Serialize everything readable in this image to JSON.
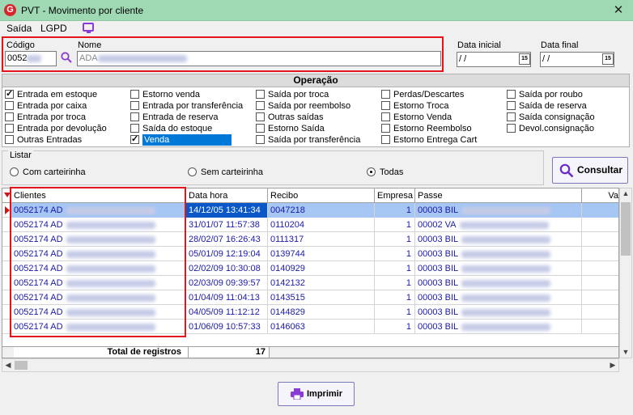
{
  "window": {
    "title": "PVT - Movimento por cliente",
    "icon_letter": "G"
  },
  "menu": {
    "items": [
      "Saída",
      "LGPD"
    ]
  },
  "search": {
    "codigo_label": "Código",
    "codigo_value": "0052",
    "nome_label": "Nome",
    "nome_value": "ADA",
    "data_inicial_label": "Data inicial",
    "data_inicial_value": " / /",
    "data_final_label": "Data final",
    "data_final_value": " / /",
    "calendar_glyph": "15"
  },
  "operacao": {
    "title": "Operação",
    "options": [
      {
        "label": "Entrada em estoque",
        "checked": true
      },
      {
        "label": "Entrada por caixa",
        "checked": false
      },
      {
        "label": "Entrada por troca",
        "checked": false
      },
      {
        "label": "Entrada por devolução",
        "checked": false
      },
      {
        "label": "Outras Entradas",
        "checked": false
      },
      {
        "label": "Estorno venda",
        "checked": false
      },
      {
        "label": "Entrada por transferência",
        "checked": false
      },
      {
        "label": "Entrada de reserva",
        "checked": false
      },
      {
        "label": "Saída do estoque",
        "checked": false
      },
      {
        "label": "Venda",
        "checked": true,
        "selected": true
      },
      {
        "label": "Saída por troca",
        "checked": false
      },
      {
        "label": "Saída por reembolso",
        "checked": false
      },
      {
        "label": "Outras saídas",
        "checked": false
      },
      {
        "label": "Estorno Saída",
        "checked": false
      },
      {
        "label": "Saída por transferência",
        "checked": false
      },
      {
        "label": "Perdas/Descartes",
        "checked": false
      },
      {
        "label": "Estorno Troca",
        "checked": false
      },
      {
        "label": "Estorno Venda",
        "checked": false
      },
      {
        "label": "Estorno Reembolso",
        "checked": false
      },
      {
        "label": "Estorno Entrega Cart",
        "checked": false
      },
      {
        "label": "Saída por roubo",
        "checked": false
      },
      {
        "label": "Saída de reserva",
        "checked": false
      },
      {
        "label": "Saída consignação",
        "checked": false
      },
      {
        "label": "Devol.consignação",
        "checked": false
      }
    ]
  },
  "listar": {
    "title": "Listar",
    "options": [
      {
        "label": "Com carteirinha",
        "selected": false
      },
      {
        "label": "Sem carteirinha",
        "selected": false
      },
      {
        "label": "Todas",
        "selected": true
      }
    ]
  },
  "consultar_label": "Consultar",
  "grid": {
    "columns": [
      "Clientes",
      "Data hora",
      "Recibo",
      "Empresa",
      "Passe",
      "Va"
    ],
    "rows": [
      {
        "cliente": "0052174 AD",
        "data_hora": "14/12/05 13:41:34",
        "recibo": "0047218",
        "empresa": "1",
        "passe": "00003 BIL"
      },
      {
        "cliente": "0052174 AD",
        "data_hora": "31/01/07 11:57:38",
        "recibo": "0110204",
        "empresa": "1",
        "passe": "00002 VA"
      },
      {
        "cliente": "0052174 AD",
        "data_hora": "28/02/07 16:26:43",
        "recibo": "0111317",
        "empresa": "1",
        "passe": "00003 BIL"
      },
      {
        "cliente": "0052174 AD",
        "data_hora": "05/01/09 12:19:04",
        "recibo": "0139744",
        "empresa": "1",
        "passe": "00003 BIL"
      },
      {
        "cliente": "0052174 AD",
        "data_hora": "02/02/09 10:30:08",
        "recibo": "0140929",
        "empresa": "1",
        "passe": "00003 BIL"
      },
      {
        "cliente": "0052174 AD",
        "data_hora": "02/03/09 09:39:57",
        "recibo": "0142132",
        "empresa": "1",
        "passe": "00003 BIL"
      },
      {
        "cliente": "0052174 AD",
        "data_hora": "01/04/09 11:04:13",
        "recibo": "0143515",
        "empresa": "1",
        "passe": "00003 BIL"
      },
      {
        "cliente": "0052174 AD",
        "data_hora": "04/05/09 11:12:12",
        "recibo": "0144829",
        "empresa": "1",
        "passe": "00003 BIL"
      },
      {
        "cliente": "0052174 AD",
        "data_hora": "01/06/09 10:57:33",
        "recibo": "0146063",
        "empresa": "1",
        "passe": "00003 BIL"
      }
    ],
    "total_label": "Total de registros",
    "total_value": "17"
  },
  "imprimir_label": "Imprimir",
  "colors": {
    "titlebar": "#9ed9b4",
    "highlight_border": "#e4141b",
    "grid_text": "#1a1aa8",
    "selection": "#0a58c8"
  }
}
